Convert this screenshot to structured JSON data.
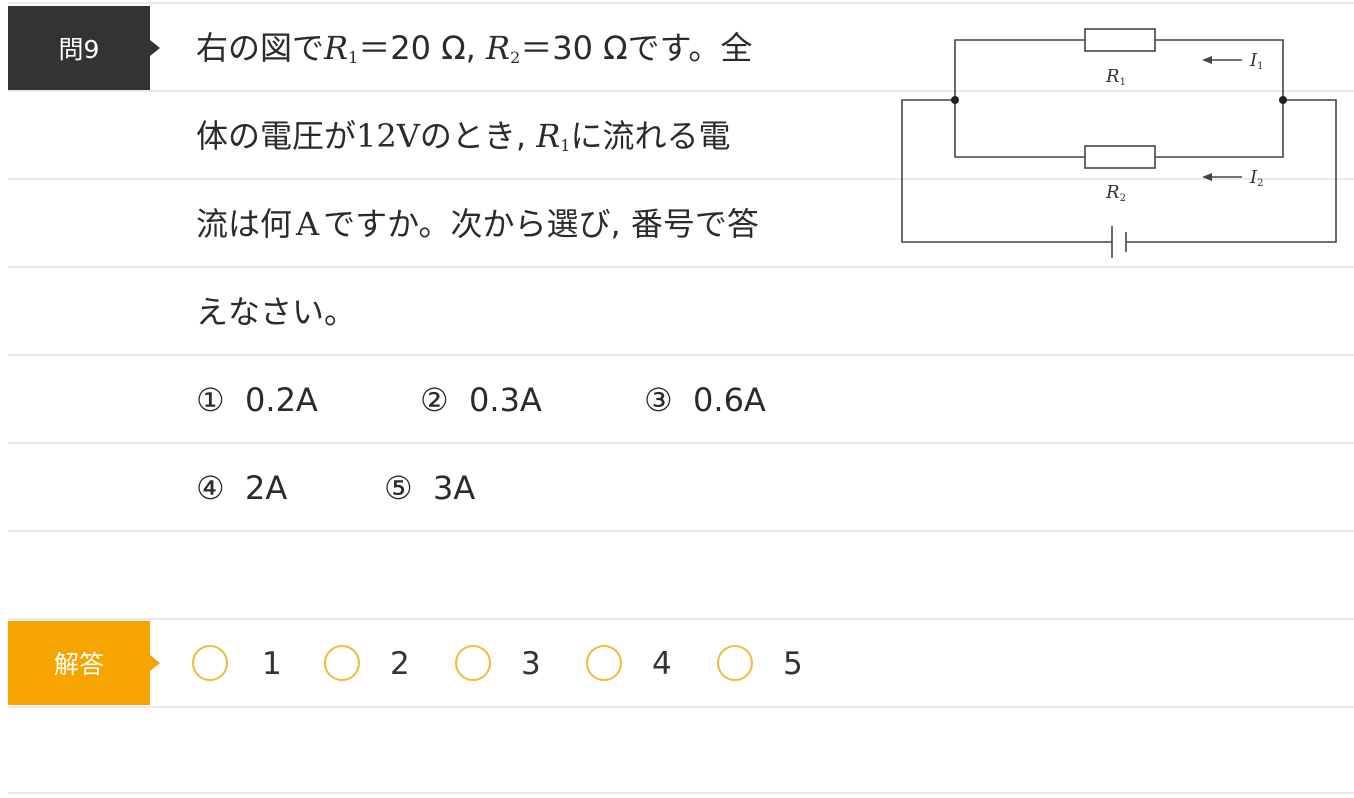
{
  "question": {
    "label": "問9",
    "line1_pre": "右の図で",
    "r1_sym": "R",
    "r1_sub": "1",
    "eq1": "＝20 Ω,",
    "r2_sym": "R",
    "r2_sub": "2",
    "eq2": "＝30 Ωです。全",
    "line2_pre": "体の電圧が",
    "voltage": "12V",
    "line2_mid": "のとき,",
    "line2_r_sym": "R",
    "line2_r_sub": "1",
    "line2_post": "に流れる電",
    "line3_pre": "流は何",
    "unit_a": "A",
    "line3_post": "ですか。次から選び, 番号で答",
    "line4": "えなさい。"
  },
  "options": [
    {
      "mark": "①",
      "value": "0.2A"
    },
    {
      "mark": "②",
      "value": "0.3A"
    },
    {
      "mark": "③",
      "value": "0.6A"
    },
    {
      "mark": "④",
      "value": "2A"
    },
    {
      "mark": "⑤",
      "value": "3A"
    }
  ],
  "diagram": {
    "r1": "R",
    "r1_sub": "1",
    "r2": "R",
    "r2_sub": "2",
    "i1": "I",
    "i1_sub": "1",
    "i2": "I",
    "i2_sub": "2"
  },
  "answer": {
    "label": "解答",
    "choices": [
      "1",
      "2",
      "3",
      "4",
      "5"
    ],
    "accent_color": "#f5a400"
  }
}
